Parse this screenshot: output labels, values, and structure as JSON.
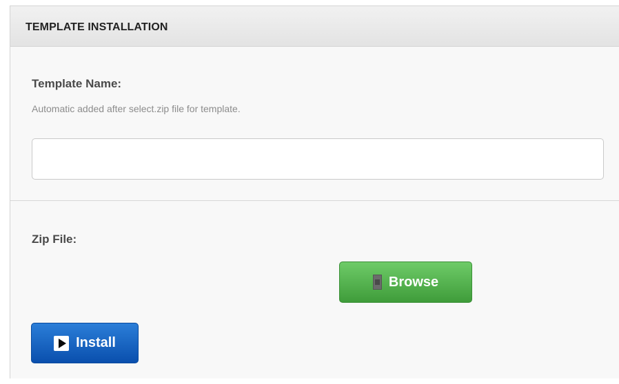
{
  "panel": {
    "title": "TEMPLATE INSTALLATION"
  },
  "template_name": {
    "label": "Template Name:",
    "help": "Automatic added after select.zip file for template.",
    "value": "",
    "placeholder": ""
  },
  "zip_file": {
    "label": "Zip File:",
    "browse_label": "Browse",
    "browse_icon": "file-icon"
  },
  "actions": {
    "install_label": "Install",
    "install_icon": "play-icon"
  },
  "colors": {
    "browse_button": "#4caf50",
    "install_button": "#1565c0",
    "header_bg": "#e8e8e8"
  }
}
